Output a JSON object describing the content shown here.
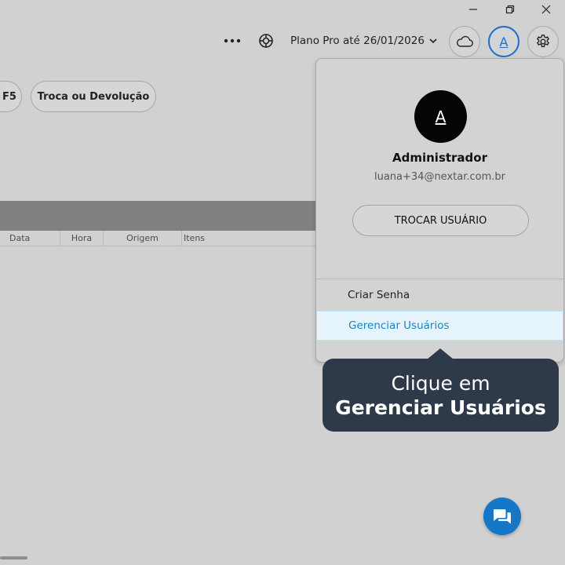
{
  "window_controls": {
    "minimize": "minimize-icon",
    "maximize": "restore-icon",
    "close": "close-icon"
  },
  "header": {
    "more_icon": "more-horizontal-icon",
    "support_icon": "lifebuoy-icon",
    "plan_label": "Plano Pro até 26/01/2026",
    "cloud_icon": "cloud-icon",
    "user_initial": "A",
    "settings_icon": "gear-icon"
  },
  "actions": {
    "pill_partial": "F5",
    "pill_troca": "Troca ou Devolução"
  },
  "table": {
    "columns": [
      "Data",
      "Hora",
      "Origem",
      "Itens"
    ]
  },
  "user_menu": {
    "avatar_initial": "A",
    "name": "Administrador",
    "email": "luana+34@nextar.com.br",
    "switch_button": "TROCAR USUÁRIO",
    "items": [
      {
        "label": "Criar Senha"
      },
      {
        "label": "Gerenciar Usuários"
      }
    ]
  },
  "tooltip": {
    "line1": "Clique em",
    "line2": "Gerenciar Usuários"
  },
  "colors": {
    "accent": "#1a6fd0",
    "highlight_text": "#1a82c4",
    "tooltip_bg": "#2e3a4a",
    "chat_fab": "#1677c8"
  }
}
